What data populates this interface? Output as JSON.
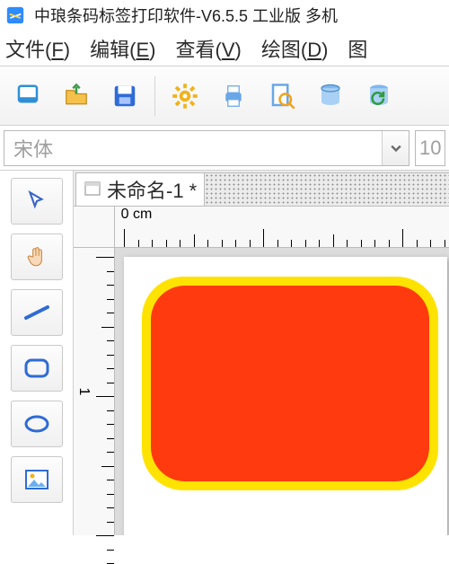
{
  "titlebar": {
    "title": "中琅条码标签打印软件-V6.5.5 工业版 多机"
  },
  "menu": {
    "file": {
      "label": "文件",
      "mn": "F"
    },
    "edit": {
      "label": "编辑",
      "mn": "E"
    },
    "view": {
      "label": "查看",
      "mn": "V"
    },
    "draw": {
      "label": "绘图",
      "mn": "D"
    },
    "extra": {
      "label": "图"
    }
  },
  "font": {
    "name": "宋体",
    "size": "10"
  },
  "tab": {
    "name": "未命名-1 *"
  },
  "ruler": {
    "zero_label": "0 cm",
    "one_label": "1"
  },
  "tools": {
    "select": "select-tool",
    "pan": "pan-tool",
    "line": "line-tool",
    "roundrect": "rounded-rectangle-tool",
    "ellipse": "ellipse-tool",
    "image": "image-tool"
  }
}
